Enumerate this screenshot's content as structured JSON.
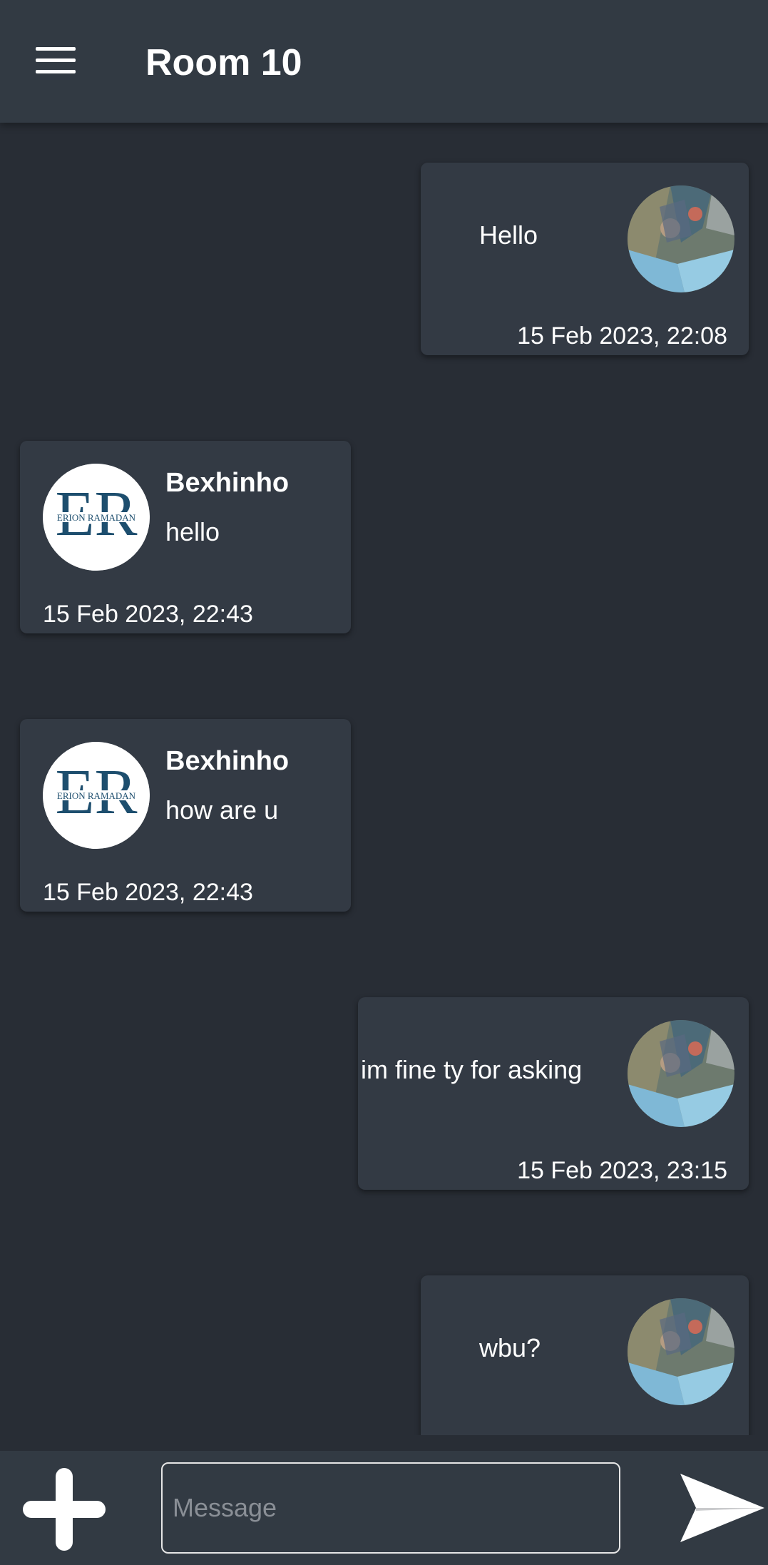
{
  "header": {
    "title": "Room 10",
    "menu_icon": "hamburger-menu-icon"
  },
  "messages": [
    {
      "side": "outgoing",
      "text": "Hello",
      "time": "15 Feb 2023, 22:08"
    },
    {
      "side": "incoming",
      "sender": "Bexhinho",
      "text": "hello",
      "time": "15 Feb 2023, 22:43",
      "avatar_logo_text": "ERION RAMADAN"
    },
    {
      "side": "incoming",
      "sender": "Bexhinho",
      "text": "how are u",
      "time": "15 Feb 2023, 22:43",
      "avatar_logo_text": "ERION RAMADAN"
    },
    {
      "side": "outgoing",
      "text": "im fine ty for asking",
      "time": "15 Feb 2023, 23:15"
    },
    {
      "side": "outgoing",
      "text": "wbu?",
      "time": ""
    }
  ],
  "composer": {
    "placeholder": "Message",
    "value": "",
    "add_icon": "plus-icon",
    "send_icon": "send-arrow-icon"
  },
  "colors": {
    "background": "#282d35",
    "surface": "#333a44",
    "bar": "#323a43",
    "logo_accent": "#1d4e6e"
  }
}
